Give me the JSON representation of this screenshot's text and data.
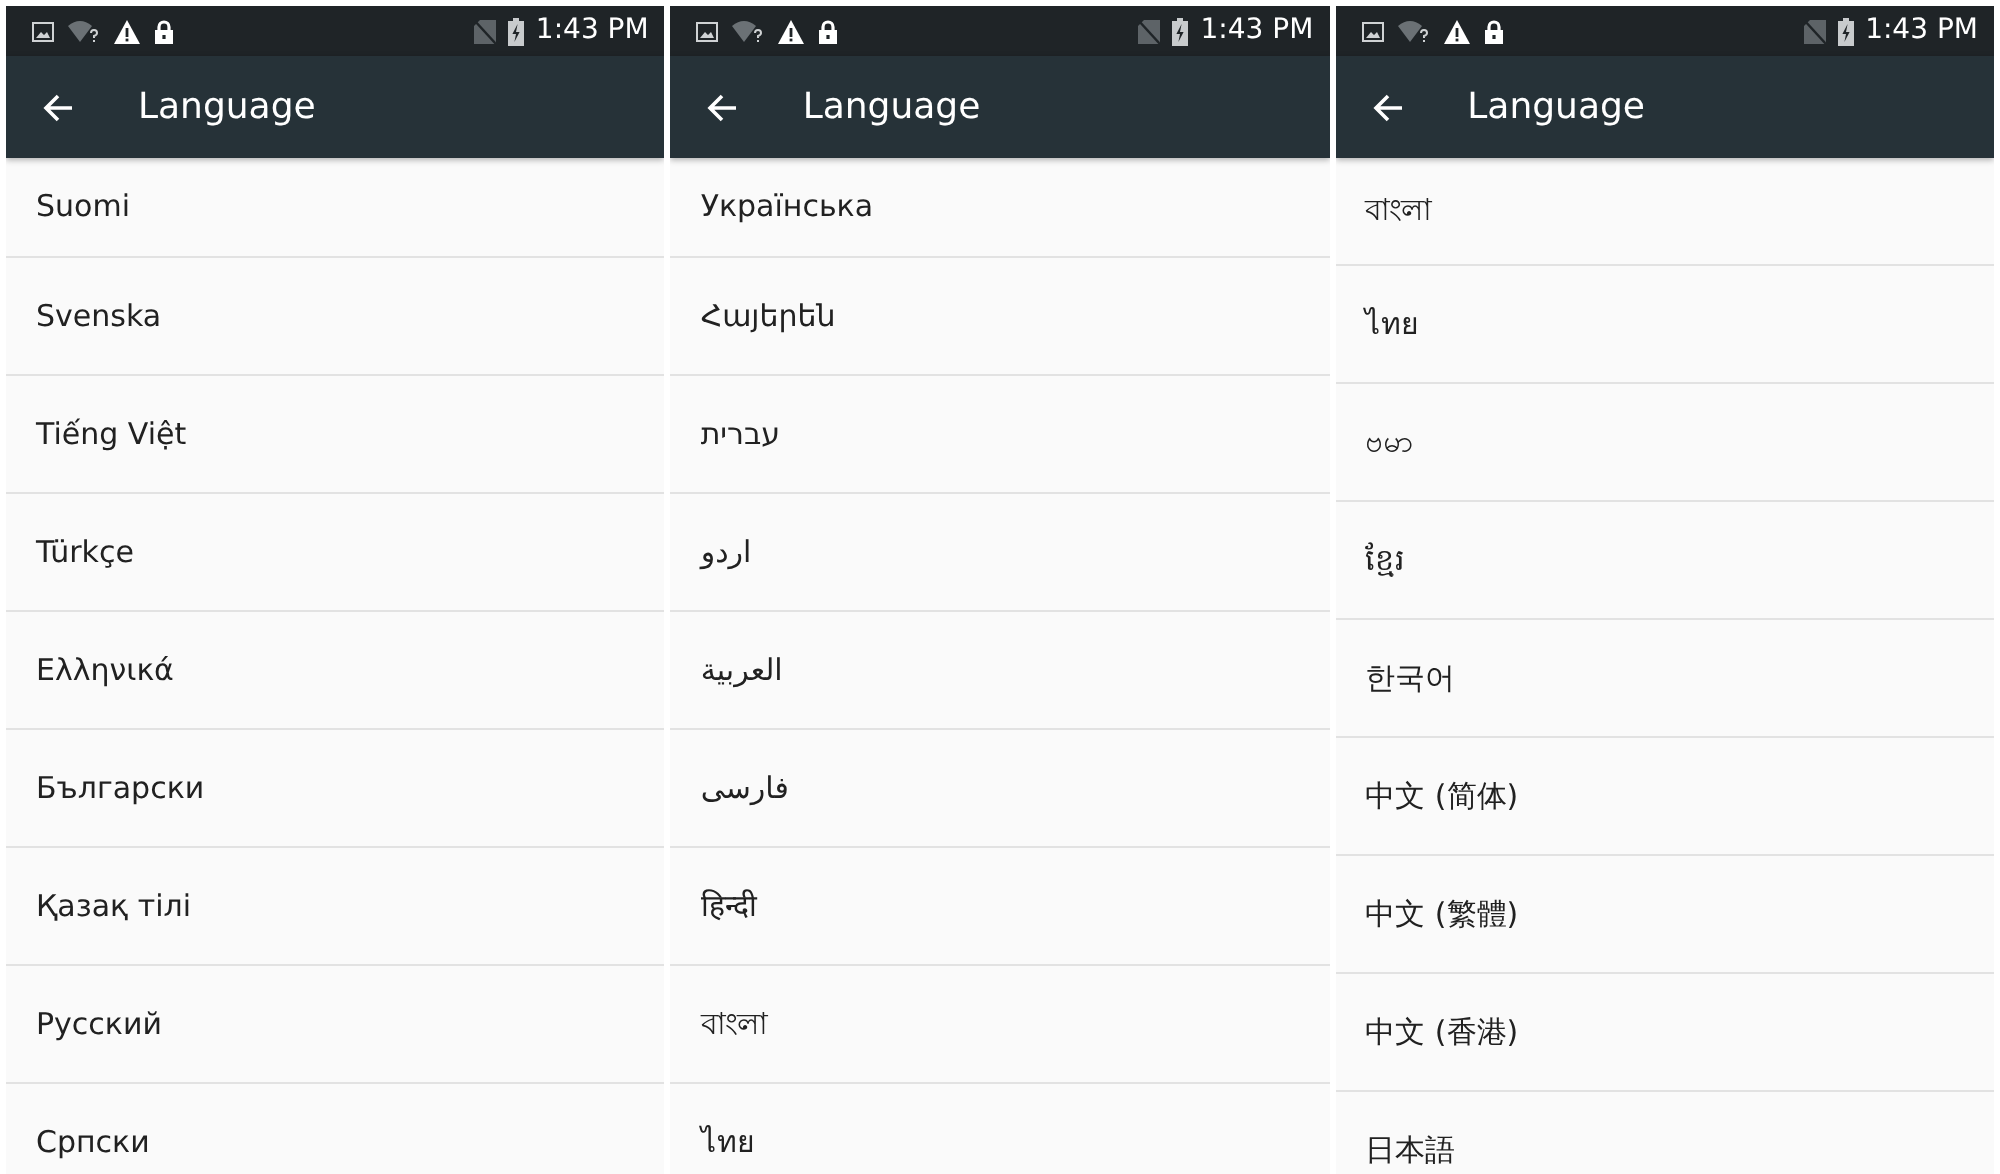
{
  "screens": [
    {
      "status_bar": {
        "time": "1:43 PM"
      },
      "toolbar": {
        "title": "Language"
      },
      "languages": [
        "Suomi",
        "Svenska",
        "Tiếng Việt",
        "Türkçe",
        "Ελληνικά",
        "Български",
        "Қазақ тілі",
        "Русский",
        "Српски"
      ]
    },
    {
      "status_bar": {
        "time": "1:43 PM"
      },
      "toolbar": {
        "title": "Language"
      },
      "languages": [
        "Українська",
        "Հայերեն",
        "עברית",
        "اردو",
        "العربية",
        "فارسی",
        "हिन्दी",
        "বাংলা",
        "ไทย"
      ]
    },
    {
      "status_bar": {
        "time": "1:43 PM"
      },
      "toolbar": {
        "title": "Language"
      },
      "languages": [
        "বাংলা",
        "ไทย",
        "ဗမာ",
        "ខ្មែរ",
        "한국어",
        "中文 (简体)",
        "中文 (繁體)",
        "中文 (香港)",
        "日本語"
      ]
    }
  ]
}
